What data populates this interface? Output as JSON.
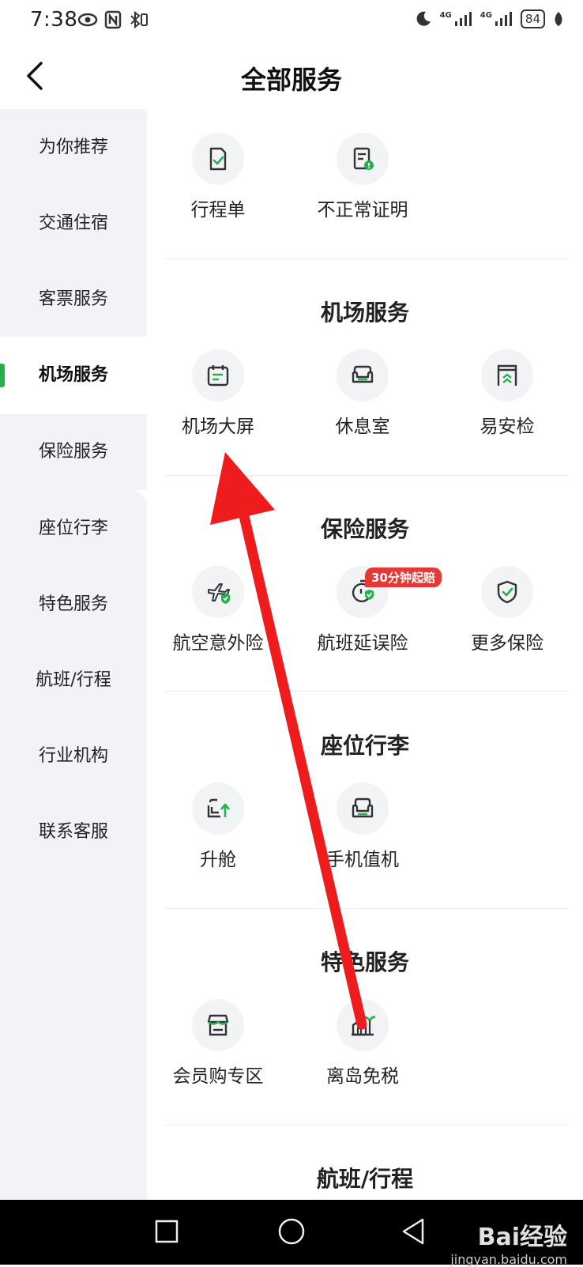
{
  "status_bar": {
    "time": "7:38",
    "battery": "84",
    "signal_left": "4G",
    "signal_right": "4G"
  },
  "header": {
    "title": "全部服务"
  },
  "sidebar": {
    "items": [
      {
        "label": "为你推荐"
      },
      {
        "label": "交通住宿"
      },
      {
        "label": "客票服务"
      },
      {
        "label": "机场服务"
      },
      {
        "label": "保险服务"
      },
      {
        "label": "座位行李"
      },
      {
        "label": "特色服务"
      },
      {
        "label": "航班/行程"
      },
      {
        "label": "行业机构"
      },
      {
        "label": "联系客服"
      }
    ],
    "active": "机场服务"
  },
  "sections": {
    "top_services": [
      {
        "label": "行程单",
        "icon": "itinerary-document-icon"
      },
      {
        "label": "不正常证明",
        "icon": "irregular-flight-certificate-icon"
      }
    ],
    "airport": {
      "title": "机场服务",
      "items": [
        {
          "label": "机场大屏",
          "icon": "airport-screen-icon"
        },
        {
          "label": "休息室",
          "icon": "lounge-sofa-icon"
        },
        {
          "label": "易安检",
          "icon": "security-check-icon"
        }
      ]
    },
    "insurance": {
      "title": "保险服务",
      "items": [
        {
          "label": "航空意外险",
          "icon": "plane-shield-icon"
        },
        {
          "label": "航班延误险",
          "icon": "delay-timer-shield-icon",
          "badge": "30分钟起赔"
        },
        {
          "label": "更多保险",
          "icon": "shield-check-icon"
        }
      ]
    },
    "seat_baggage": {
      "title": "座位行李",
      "items": [
        {
          "label": "升舱",
          "icon": "upgrade-seat-icon"
        },
        {
          "label": "手机值机",
          "icon": "seat-checkin-icon"
        }
      ]
    },
    "special": {
      "title": "特色服务",
      "items": [
        {
          "label": "会员购专区",
          "icon": "member-shop-icon"
        },
        {
          "label": "离岛免税",
          "icon": "island-dutyfree-icon"
        }
      ]
    },
    "flight_trip": {
      "title": "航班/行程"
    }
  },
  "nav_bar": {
    "watermark_brand": "Bai经验",
    "watermark_url": "jingyan.baidu.com"
  },
  "colors": {
    "accent": "#22b14c",
    "badge": "#e53935",
    "arrow": "#ee1c1c",
    "sidebar_bg": "#f2f3f7"
  }
}
